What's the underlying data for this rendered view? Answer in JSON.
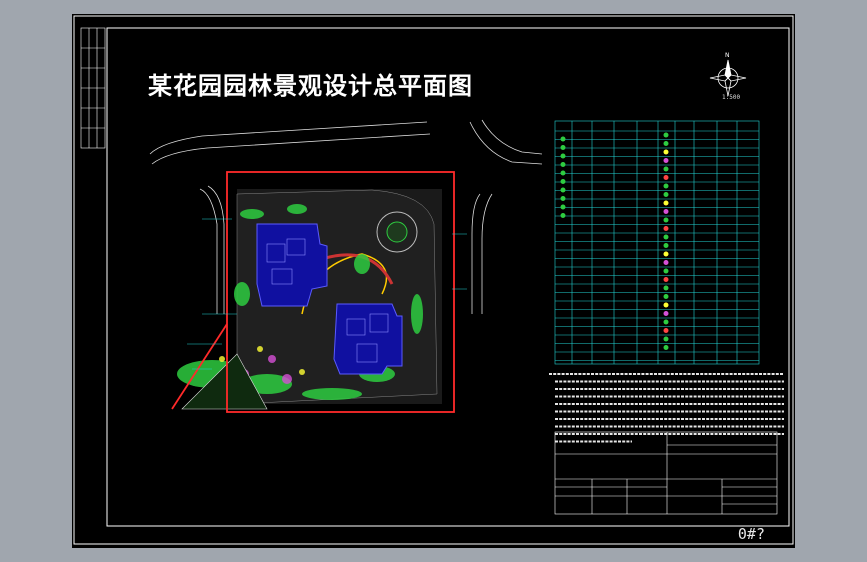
{
  "drawing": {
    "title": "某花园园林景观设计总平面图",
    "sheet_number": "0#?",
    "scale_text": "1:500"
  },
  "colors": {
    "background": "#a0a6ae",
    "sheet": "#000000",
    "border": "#ffffff",
    "site_boundary": "#ff2a2a",
    "table_lines": "#22d3d3",
    "planting": "#2ecc40",
    "buildings": "#3a3aff"
  },
  "icons": {
    "north_arrow": "compass-rose-icon"
  }
}
